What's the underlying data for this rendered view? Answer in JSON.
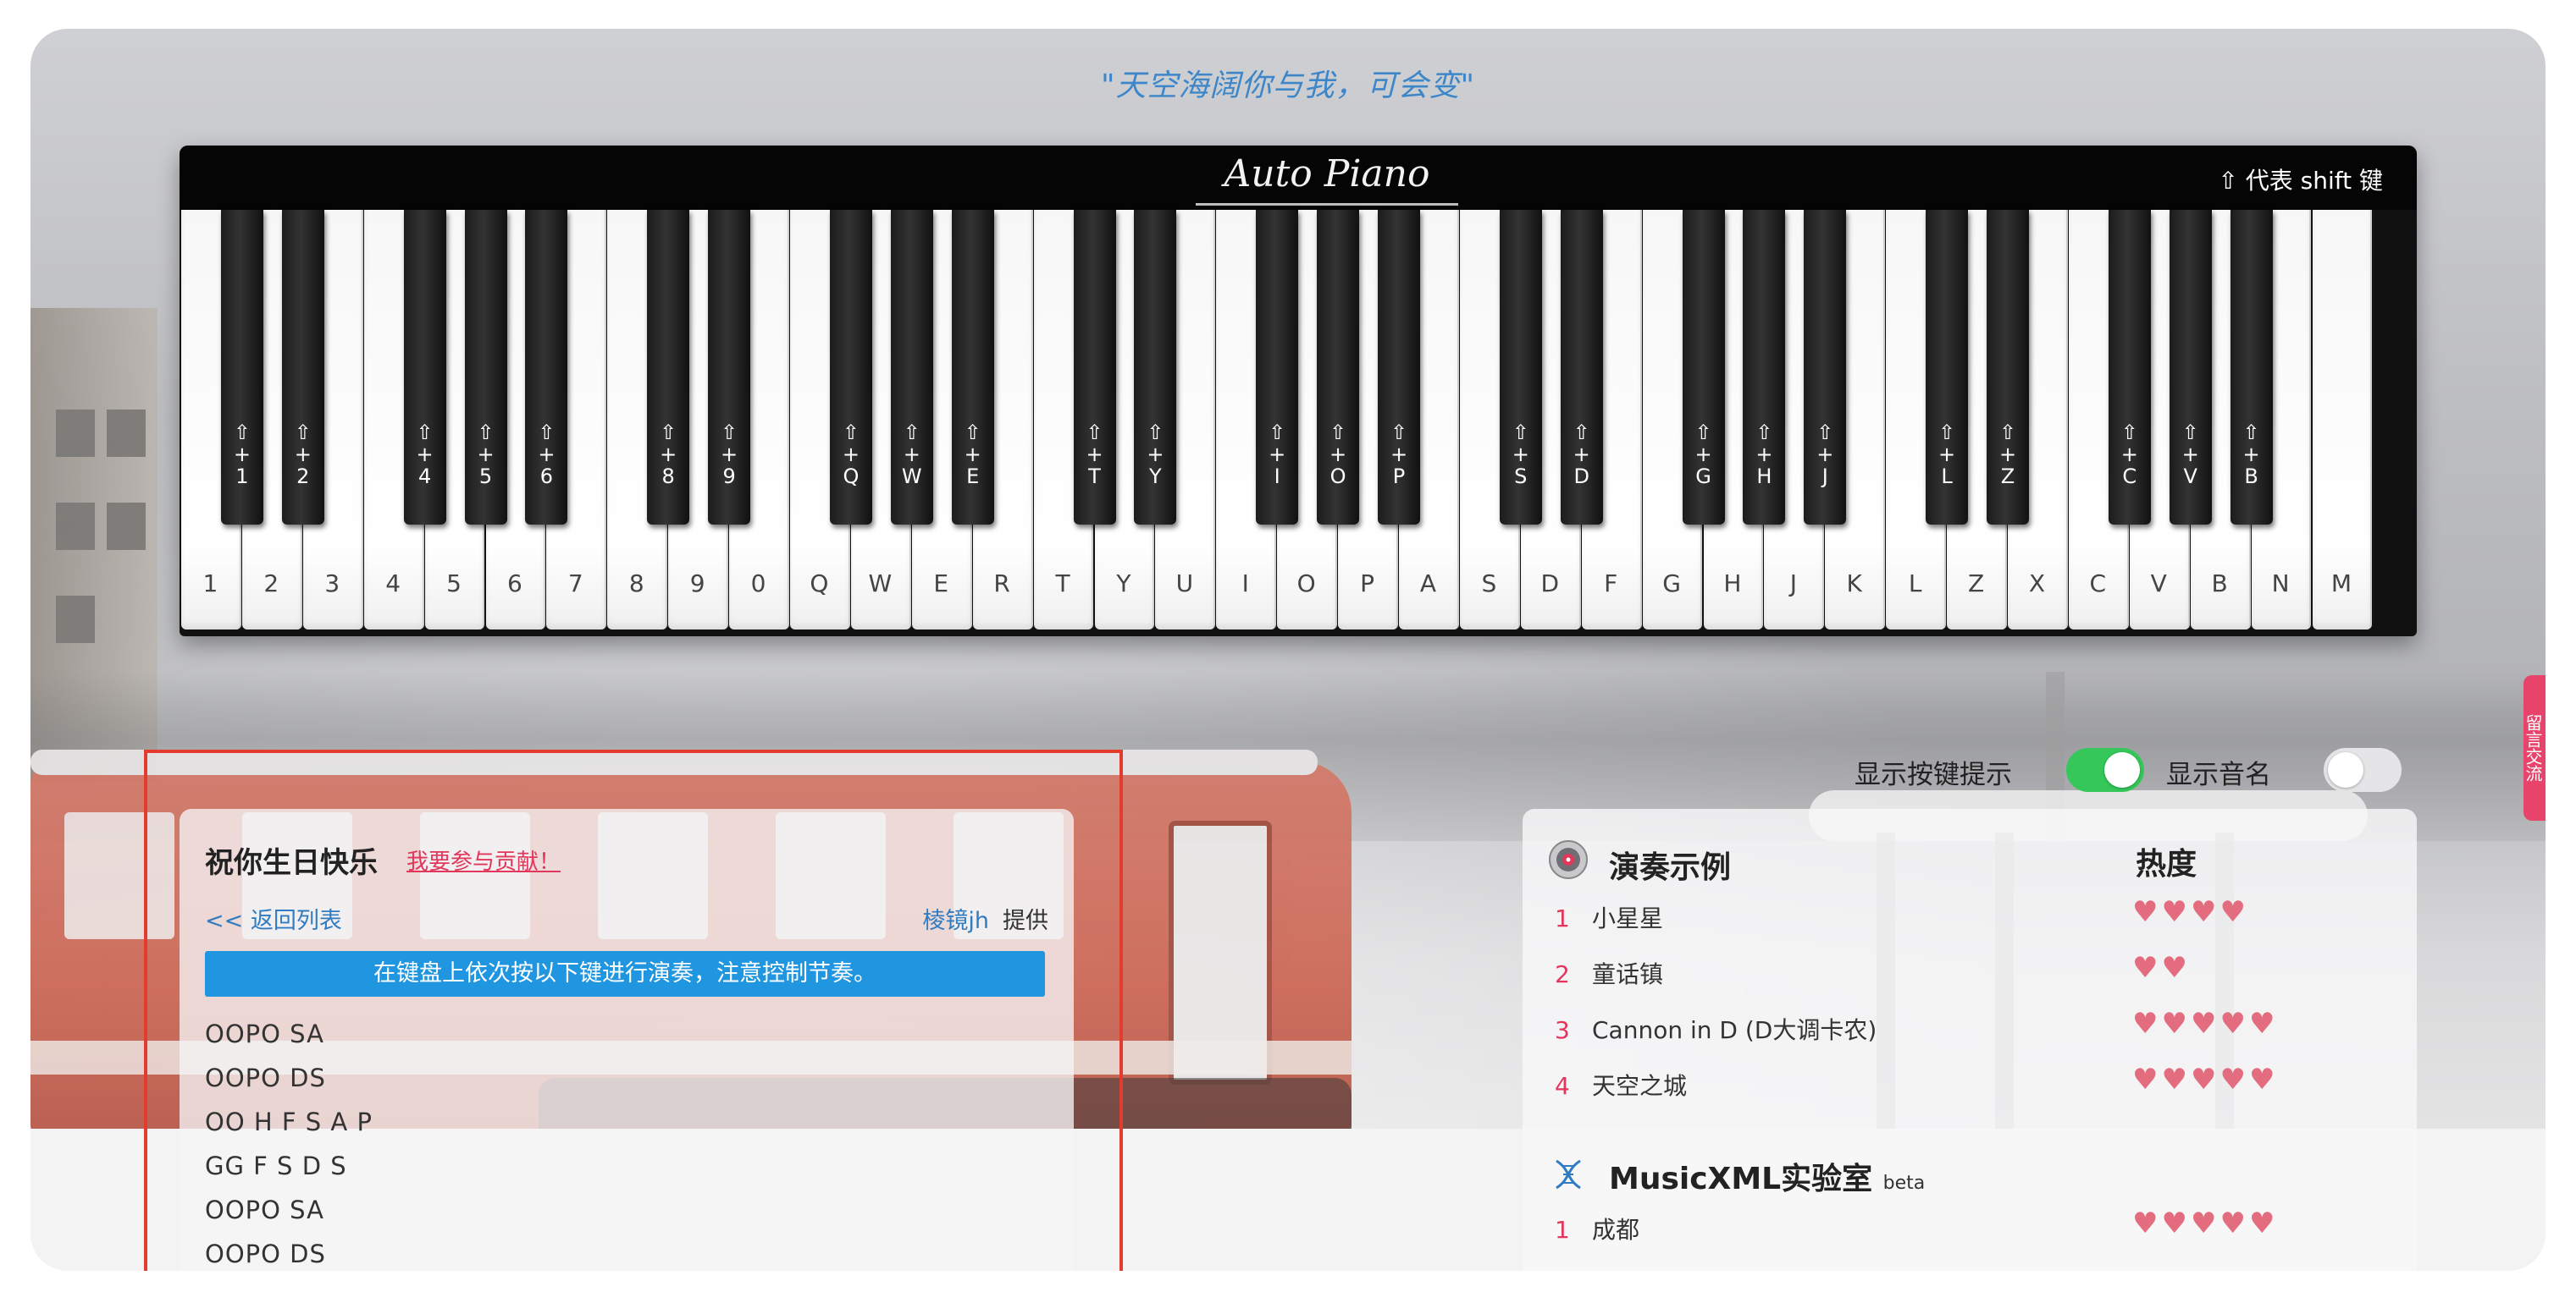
{
  "quote": "\"天空海阔你与我，可会变\"",
  "piano": {
    "logo": "Auto Piano",
    "shift_hint": "⇧ 代表 shift 键",
    "white_keys": [
      "1",
      "2",
      "3",
      "4",
      "5",
      "6",
      "7",
      "8",
      "9",
      "0",
      "Q",
      "W",
      "E",
      "R",
      "T",
      "Y",
      "U",
      "I",
      "O",
      "P",
      "A",
      "S",
      "D",
      "F",
      "G",
      "H",
      "J",
      "K",
      "L",
      "Z",
      "X",
      "C",
      "V",
      "B",
      "N",
      "M"
    ],
    "black_keys": [
      "⇧\n+\n1",
      "⇧\n+\n2",
      "⇧\n+\n4",
      "⇧\n+\n5",
      "⇧\n+\n6",
      "⇧\n+\n8",
      "⇧\n+\n9",
      "⇧\n+\nQ",
      "⇧\n+\nW",
      "⇧\n+\nE",
      "⇧\n+\nT",
      "⇧\n+\nY",
      "⇧\n+\nI",
      "⇧\n+\nO",
      "⇧\n+\nP",
      "⇧\n+\nS",
      "⇧\n+\nD",
      "⇧\n+\nG",
      "⇧\n+\nH",
      "⇧\n+\nJ",
      "⇧\n+\nL",
      "⇧\n+\nZ",
      "⇧\n+\nC",
      "⇧\n+\nV",
      "⇧\n+\nB"
    ]
  },
  "toggles": {
    "show_keys_label": "显示按键提示",
    "show_keys_on": true,
    "show_notes_label": "显示音名",
    "show_notes_on": false
  },
  "song": {
    "title": "祝你生日快乐",
    "contribute_link": "我要参与贡献！",
    "back_link": "<< 返回列表",
    "provider_name": "棱镜jh",
    "provider_suffix": "提供",
    "instruction": "在键盘上依次按以下键进行演奏，注意控制节奏。",
    "score_lines": [
      "OOPO SA",
      "OOPO DS",
      "OO H F S A P",
      "GG F S D S",
      "OOPO SA",
      "OOPO DS"
    ]
  },
  "examples": {
    "title": "演奏示例",
    "heat_label": "热度",
    "items": [
      {
        "index": "1",
        "name": "小星星",
        "heat": 4
      },
      {
        "index": "2",
        "name": "童话镇",
        "heat": 2
      },
      {
        "index": "3",
        "name": "Cannon in D (D大调卡农)",
        "heat": 5
      },
      {
        "index": "4",
        "name": "天空之城",
        "heat": 5
      }
    ],
    "lab_title": "MusicXML实验室",
    "lab_badge": "beta",
    "lab_items": [
      {
        "index": "1",
        "name": "成都",
        "heat": 5
      }
    ]
  },
  "side_tab": "留言交流",
  "colors": {
    "accent_blue": "#2196e0",
    "link_blue": "#2f7cc2",
    "link_red": "#e2365a",
    "toggle_on": "#35c75a",
    "highlight_red": "#e43b2f"
  }
}
